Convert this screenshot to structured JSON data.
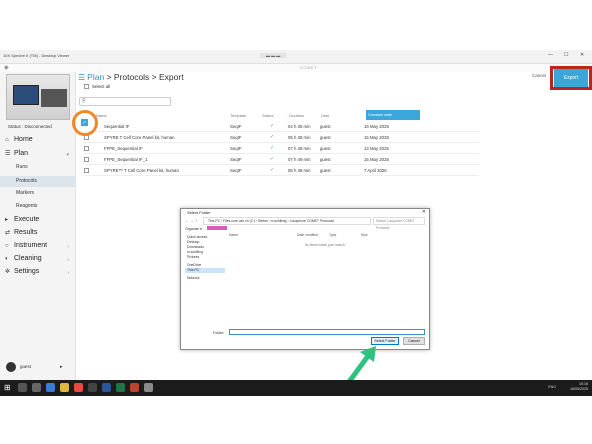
{
  "window": {
    "title": "10X Spectre II (TM) - Desktop Viewer",
    "center_label": "COMET",
    "app_name": "COMET"
  },
  "sidebar": {
    "status": "Status : Disconnected",
    "items": [
      {
        "label": "Home",
        "icon": "home-icon"
      },
      {
        "label": "Plan",
        "icon": "plan-icon"
      },
      {
        "label": "Execute",
        "icon": "execute-icon"
      },
      {
        "label": "Results",
        "icon": "results-icon"
      },
      {
        "label": "Instrument",
        "icon": "instrument-icon"
      },
      {
        "label": "Cleaning",
        "icon": "cleaning-icon"
      },
      {
        "label": "Settings",
        "icon": "settings-icon"
      }
    ],
    "plan_sub": [
      "Runs",
      "Protocols",
      "Markers",
      "Reagents"
    ],
    "user": "guest"
  },
  "header": {
    "crumb_plan": "Plan",
    "crumb_rest": " > Protocols > Export",
    "cancel": "Cancel",
    "export": "Export"
  },
  "list": {
    "select_all": "Select all",
    "search_placeholder": "",
    "columns": [
      "Name",
      "Template",
      "Status",
      "Duration",
      "User",
      "Creation date"
    ],
    "rows": [
      {
        "name": "Sequential IF",
        "template": "SeqIF",
        "status": "✓",
        "duration": "04 h 36 min",
        "user": "guest",
        "date": "16 May 2025"
      },
      {
        "name": "SPYRE T Cell Core Panel kit, human",
        "template": "SeqIF",
        "status": "✓",
        "duration": "05 h 38 min",
        "user": "guest",
        "date": "15 May 2025"
      },
      {
        "name": "FFPE_Sequential IF",
        "template": "SeqIF",
        "status": "✓",
        "duration": "07 h 49 min",
        "user": "guest",
        "date": "14 May 2025"
      },
      {
        "name": "FFPE_Sequential IF_1",
        "template": "SeqIF",
        "status": "✓",
        "duration": "07 h 49 min",
        "user": "guest",
        "date": "15 May 2025"
      },
      {
        "name": "SPYRE™ T Cell Core Panel kit, human",
        "template": "SeqIF",
        "status": "✓",
        "duration": "05 h 38 min",
        "user": "guest",
        "date": "7 April 2025"
      }
    ]
  },
  "dialog": {
    "title": "Select Folder",
    "path": "This PC  ›  Files.core.uzh.ch (Z:)  ›  Stefan  ›  m.schilling  ›  Lunaphore COMET Protocols",
    "search": "Search Lunaphore COMET Protocols",
    "organize": "Organize ▾",
    "newfolder": "New folder",
    "side": [
      "Quick access",
      "Desktop",
      "Downloads",
      "m.schilling",
      "Pictures",
      "OneDrive",
      "This PC",
      "Network"
    ],
    "cols": [
      "Name",
      "Date modified",
      "Type",
      "Size"
    ],
    "empty": "No items match your search.",
    "folder_label": "Folder:",
    "select_btn": "Select Folder",
    "cancel_btn": "Cancel"
  },
  "taskbar": {
    "time": "15:16",
    "date": "16/05/2025",
    "lang": "ENG"
  }
}
